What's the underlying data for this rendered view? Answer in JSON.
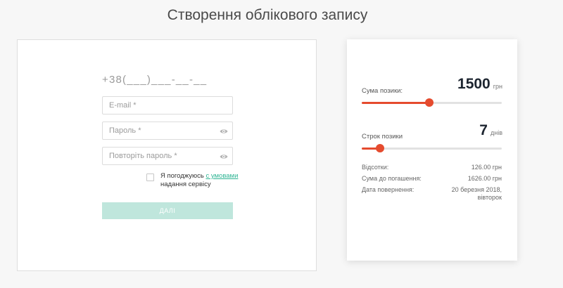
{
  "page": {
    "title": "Створення облікового запису"
  },
  "form": {
    "phone_mask": "+38(___)___-__-__",
    "email_placeholder": "E-mail *",
    "password_placeholder": "Пароль *",
    "password_repeat_placeholder": "Повторіть пароль *",
    "agree_prefix": "Я погоджуюсь ",
    "agree_link": "с умовами",
    "agree_suffix": " надання сервісу",
    "agree_checked": false,
    "next_label": "ДАЛІ"
  },
  "loan": {
    "amount_label": "Сума позики:",
    "amount_value": "1500",
    "amount_unit": "грн",
    "amount_slider_fraction": 0.48,
    "term_label": "Строк позики",
    "term_value": "7",
    "term_unit": "днів",
    "term_slider_fraction": 0.13,
    "details": [
      {
        "label": "Відсотки:",
        "value": "126.00 грн"
      },
      {
        "label": "Сума до погашення:",
        "value": "1626.00 грн"
      },
      {
        "label": "Дата повернення:",
        "value": "20 березня 2018,\nвівторок"
      }
    ]
  },
  "colors": {
    "accent": "#e54b2e",
    "link": "#2fb594",
    "button_disabled": "#bfe6dc"
  },
  "icons": {
    "password_toggle": "eye-icon"
  }
}
